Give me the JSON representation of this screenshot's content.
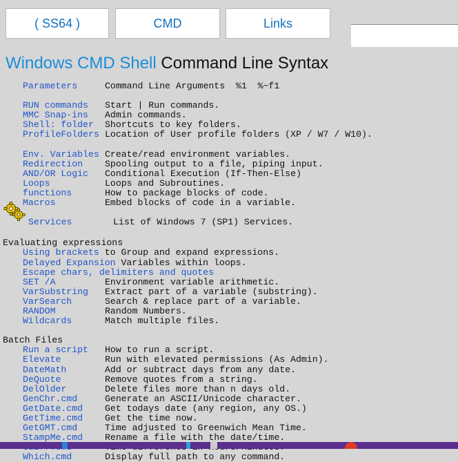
{
  "nav": {
    "buttons": [
      "( SS64 )",
      "CMD",
      "Links"
    ]
  },
  "title": {
    "link_part": "Windows CMD Shell",
    "rest": "Command Line Syntax"
  },
  "groups": [
    [
      {
        "name": "Parameters",
        "desc": "Command Line Arguments  %1  %~f1"
      }
    ],
    [
      {
        "name": "RUN commands",
        "desc": "Start | Run commands."
      },
      {
        "name": "MMC Snap-ins",
        "desc": "Admin commands."
      },
      {
        "name": "Shell: folder",
        "desc": "Shortcuts to key folders."
      },
      {
        "name": "ProfileFolders",
        "desc": "Location of User profile folders (XP / W7 / W10)."
      }
    ],
    [
      {
        "name": "Env. Variables",
        "desc": "Create/read environment variables."
      },
      {
        "name": "Redirection",
        "desc": "Spooling output to a file, piping input."
      },
      {
        "name": "AND/OR Logic",
        "desc": "Conditional Execution (If-Then-Else)"
      },
      {
        "name": "Loops",
        "desc": "Loops and Subroutines."
      },
      {
        "name": "functions",
        "desc": "How to package blocks of code."
      },
      {
        "name": "Macros",
        "desc": "Embed blocks of code in a variable."
      }
    ]
  ],
  "services": {
    "name": "Services",
    "desc": "List of Windows 7 (SP1) Services."
  },
  "expressions": {
    "heading": "Evaluating expressions",
    "brackets": {
      "name": "Using brackets",
      "desc": "to Group and expand expressions."
    },
    "delayed": {
      "name": "Delayed Expansion",
      "desc": "Variables within loops."
    },
    "escape": {
      "name": "Escape chars,",
      "name2": "delimiters and quotes"
    },
    "items": [
      {
        "name": "SET /A",
        "desc": "Environment variable arithmetic."
      },
      {
        "name": "VarSubstring",
        "desc": "Extract part of a variable (substring)."
      },
      {
        "name": "VarSearch",
        "desc": "Search & replace part of a variable."
      },
      {
        "name": "RANDOM",
        "desc": "Random Numbers."
      },
      {
        "name": "Wildcards",
        "desc": "Match multiple files."
      }
    ]
  },
  "batch": {
    "heading": "Batch Files",
    "items": [
      {
        "name": "Run a script",
        "desc": "How to run a script."
      },
      {
        "name": "Elevate",
        "desc": "Run with elevated permissions (As Admin)."
      },
      {
        "name": "DateMath",
        "desc": "Add or subtract days from any date."
      },
      {
        "name": "DeQuote",
        "desc": "Remove quotes from a string."
      },
      {
        "name": "DelOlder",
        "desc": "Delete files more than n days old."
      },
      {
        "name": "GenChr.cmd",
        "desc": "Generate an ASCII/Unicode character."
      },
      {
        "name": "GetDate.cmd",
        "desc": "Get todays date (any region, any OS.)"
      },
      {
        "name": "GetTime.cmd",
        "desc": "Get the time now."
      },
      {
        "name": "GetGMT.cmd",
        "desc": "Time adjusted to Greenwich Mean Time."
      },
      {
        "name": "StampMe.cmd",
        "desc": "Rename a file with the date/time."
      },
      {
        "name": "tdiff.cmd",
        "desc": "Time difference in Hours/Minutes."
      },
      {
        "name": "Which.cmd",
        "desc": "Display full path to any command."
      }
    ]
  },
  "icons": {
    "services": "gears-icon"
  },
  "colors": {
    "link": "#2155c8",
    "nav_text": "#1570c0",
    "background": "#d6d6d6"
  }
}
